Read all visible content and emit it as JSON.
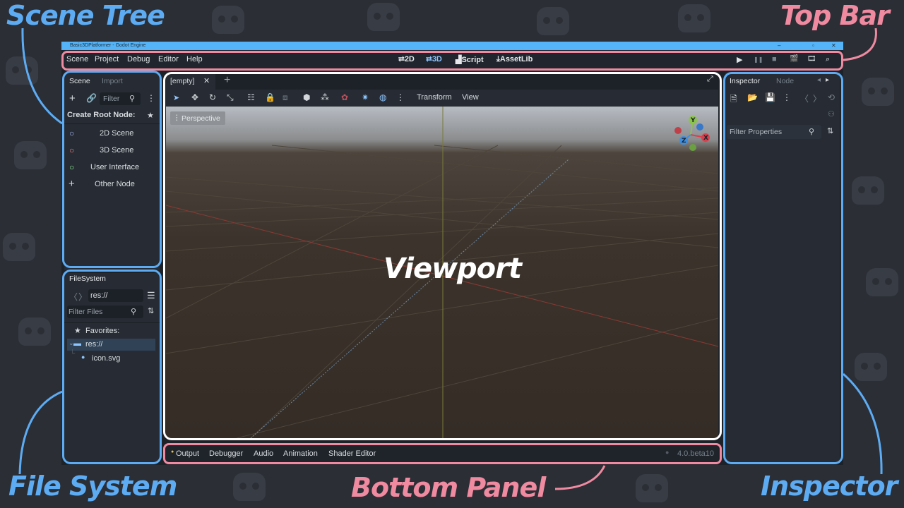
{
  "callouts": {
    "scene_tree": "Scene Tree",
    "top_bar": "Top Bar",
    "file_system": "File System",
    "bottom_panel": "Bottom Panel",
    "inspector": "Inspector",
    "viewport": "Viewport"
  },
  "window": {
    "title": "Basic3DPlatformer - Godot Engine",
    "minimize": "–",
    "maximize": "▫",
    "close": "✕"
  },
  "menu": [
    "Scene",
    "Project",
    "Debug",
    "Editor",
    "Help"
  ],
  "workspaces": [
    {
      "label": "2D",
      "icon": "⮂"
    },
    {
      "label": "3D",
      "icon": "⮂",
      "active": true
    },
    {
      "label": "Script",
      "icon": "▟"
    },
    {
      "label": "AssetLib",
      "icon": "⤓"
    }
  ],
  "run_controls": {
    "play": "▶",
    "pause": "❚❚",
    "stop": "■",
    "play_scene": "🎬",
    "play_custom": "🎞",
    "movie": "⌕"
  },
  "scene_dock": {
    "tabs": [
      "Scene",
      "Import"
    ],
    "filter_placeholder": "Filter",
    "create_root_label": "Create Root Node:",
    "nodes": [
      {
        "label": "2D Scene",
        "icon": "○",
        "color": "#a5b7f3"
      },
      {
        "label": "3D Scene",
        "icon": "○",
        "color": "#fc7f7f"
      },
      {
        "label": "User Interface",
        "icon": "○",
        "color": "#8eef97"
      },
      {
        "label": "Other Node",
        "icon": "+",
        "color": "#e0e0e0"
      }
    ]
  },
  "filesystem_dock": {
    "tab": "FileSystem",
    "path": "res://",
    "filter_placeholder": "Filter Files",
    "favorites_label": "Favorites:",
    "items": [
      {
        "label": "res://",
        "type": "folder"
      },
      {
        "label": "icon.svg",
        "type": "file"
      }
    ]
  },
  "viewport": {
    "scene_tab": "[empty]",
    "close_tab": "✕",
    "add_tab": "+",
    "toolbar_menus": [
      "Transform",
      "View"
    ],
    "perspective_label": "Perspective",
    "gizmo_axes": [
      "Y",
      "X",
      "Z"
    ]
  },
  "inspector_dock": {
    "tabs": [
      "Inspector",
      "Node"
    ],
    "filter_placeholder": "Filter Properties"
  },
  "bottom_panel": {
    "tabs": [
      "Output",
      "Debugger",
      "Audio",
      "Animation",
      "Shader Editor"
    ],
    "version": "4.0.beta10"
  },
  "colors": {
    "accent_blue": "#5dacf3",
    "accent_pink": "#f08aa0",
    "titlebar": "#55b4f7"
  }
}
